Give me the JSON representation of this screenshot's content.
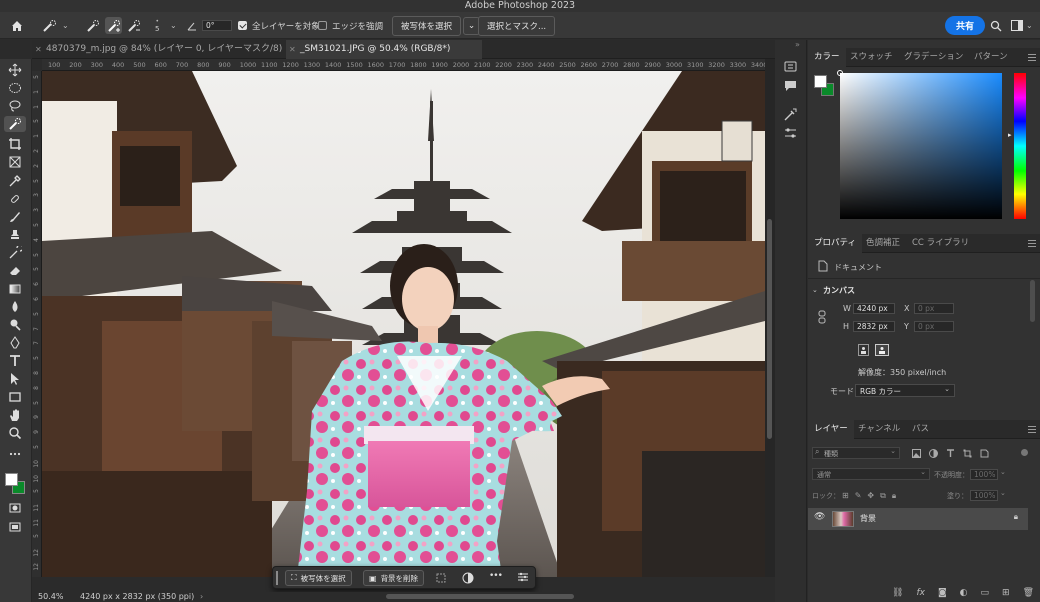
{
  "app": {
    "title": "Adobe Photoshop 2023"
  },
  "options": {
    "angle": "0°",
    "brush_size": "5",
    "sample_all_layers": "全レイヤーを対象",
    "enhance_edge": "エッジを強調",
    "select_subject": "被写体を選択",
    "select_and_mask": "選択とマスク...",
    "share": "共有"
  },
  "tabs": [
    {
      "label": "4870379_m.jpg @ 84% (レイヤー 0, レイヤーマスク/8) *"
    },
    {
      "label": "_SM31021.JPG @ 50.4% (RGB/8*)"
    }
  ],
  "ruler_top": [
    "100",
    "200",
    "300",
    "400",
    "500",
    "600",
    "700",
    "800",
    "900",
    "1000",
    "1100",
    "1200",
    "1300",
    "1400",
    "1500",
    "1600",
    "1700",
    "1800",
    "1900",
    "2000",
    "2100",
    "2200",
    "2300",
    "2400",
    "2500",
    "2600",
    "2700",
    "2800",
    "2900",
    "3000",
    "3100",
    "3200",
    "3300",
    "3400"
  ],
  "ruler_left": [
    "5",
    "1",
    "1",
    "5",
    "1",
    "2",
    "2",
    "5",
    "3",
    "3",
    "5",
    "4",
    "5",
    "5",
    "6",
    "6",
    "5",
    "7",
    "7",
    "5",
    "8",
    "8",
    "5",
    "9",
    "9",
    "5",
    "10",
    "10",
    "5",
    "11",
    "11",
    "5",
    "12",
    "12"
  ],
  "status": {
    "zoom": "50.4%",
    "doc_size": "4240 px x 2832 px (350 ppi)"
  },
  "context_bar": {
    "select_subject": "被写体を選択",
    "remove_background": "背景を削除",
    "more": "•••"
  },
  "color_panel": {
    "tabs": [
      "カラー",
      "スウォッチ",
      "グラデーション",
      "パターン"
    ],
    "foreground": "#ffffff",
    "background": "#0a8a2a"
  },
  "properties_panel": {
    "tabs": [
      "プロパティ",
      "色調補正",
      "CC ライブラリ"
    ],
    "document_label": "ドキュメント",
    "canvas_label": "カンバス",
    "w_label": "W",
    "w_value": "4240 px",
    "h_label": "H",
    "h_value": "2832 px",
    "x_label": "X",
    "x_value": "0 px",
    "y_label": "Y",
    "y_value": "0 px",
    "resolution": "解像度：350 pixel/inch",
    "mode_label": "モード",
    "mode_value": "RGB カラー"
  },
  "layers_panel": {
    "tabs": [
      "レイヤー",
      "チャンネル",
      "パス"
    ],
    "filter_kind": "種類",
    "blend_mode": "通常",
    "opacity_label": "不透明度：",
    "opacity_value": "100%",
    "lock_label": "ロック：",
    "fill_label": "塗り：",
    "fill_value": "100%",
    "layers": [
      {
        "name": "背景"
      }
    ],
    "bottom_icons": [
      "link-icon",
      "fx",
      "mask-icon",
      "adjustment-icon",
      "folder-icon",
      "new-layer-icon",
      "trash-icon"
    ]
  }
}
